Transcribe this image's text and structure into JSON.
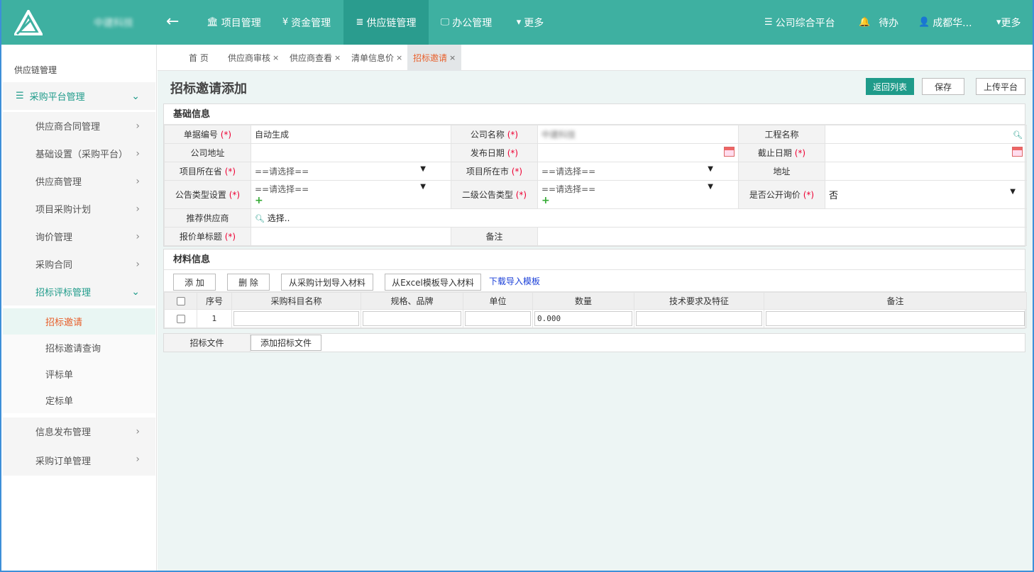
{
  "top_nav": {
    "brand": "中建科技",
    "items": [
      {
        "icon": "bank-icon",
        "glyph": "🏛",
        "label": "项目管理"
      },
      {
        "icon": "yen-icon",
        "glyph": "¥",
        "label": "资金管理"
      },
      {
        "icon": "database-icon",
        "glyph": "≣",
        "label": "供应链管理",
        "active": true
      },
      {
        "icon": "monitor-icon",
        "glyph": "🖵",
        "label": "办公管理"
      },
      {
        "icon": "caret-down-icon",
        "glyph": "▾",
        "label": "更多"
      }
    ],
    "right": {
      "platform": "公司综合平台",
      "todo": "待办",
      "user": "成都华...",
      "more": "更多"
    }
  },
  "sidebar": {
    "title": "供应链管理",
    "group": "采购平台管理",
    "items": [
      "供应商合同管理",
      "基础设置（采购平台）",
      "供应商管理",
      "项目采购计划",
      "询价管理",
      "采购合同",
      "招标评标管理"
    ],
    "subitems": [
      "招标邀请",
      "招标邀请查询",
      "评标单",
      "定标单"
    ],
    "items_after": [
      "信息发布管理",
      "采购订单管理"
    ]
  },
  "tabs": [
    {
      "label": "首 页"
    },
    {
      "label": "供应商审核",
      "closable": true
    },
    {
      "label": "供应商查看",
      "closable": true
    },
    {
      "label": "清单信息价",
      "closable": true
    },
    {
      "label": "招标邀请",
      "closable": true,
      "active": true
    }
  ],
  "page": {
    "title": "招标邀请添加",
    "buttons": {
      "back": "返回列表",
      "save": "保存",
      "upload": "上传平台"
    }
  },
  "basic_info": {
    "header": "基础信息",
    "doc_no_label": "单据编号",
    "doc_no_value": "自动生成",
    "company_label": "公司名称",
    "company_value": "中建科技",
    "project_label": "工程名称",
    "address_label": "公司地址",
    "publish_date_label": "发布日期",
    "deadline_label": "截止日期",
    "province_label": "项目所在省",
    "city_label": "项目所在市",
    "site_address_label": "地址",
    "notice_type_label": "公告类型设置",
    "sub_notice_type_label": "二级公告类型",
    "public_inquiry_label": "是否公开询价",
    "public_inquiry_value": "否",
    "select_placeholder": "==请选择==",
    "supplier_label": "推荐供应商",
    "supplier_select": "选择..",
    "quote_title_label": "报价单标题",
    "remark_label": "备注",
    "required_mark": "(*)"
  },
  "material": {
    "header": "材料信息",
    "buttons": {
      "add": "添 加",
      "delete": "删 除",
      "import_plan": "从采购计划导入材料",
      "import_excel": "从Excel模板导入材料"
    },
    "download_link": "下载导入模板",
    "columns": [
      "序号",
      "采购科目名称",
      "规格、品牌",
      "单位",
      "数量",
      "技术要求及特征",
      "备注"
    ],
    "rows": [
      {
        "no": "1",
        "qty": "0.000"
      }
    ]
  },
  "attachment": {
    "label": "招标文件",
    "button": "添加招标文件"
  }
}
